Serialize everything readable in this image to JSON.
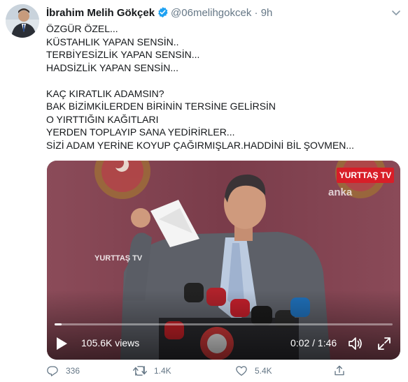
{
  "tweet": {
    "display_name": "İbrahim Melih Gökçek",
    "handle": "@06melihgokcek",
    "separator": "·",
    "time": "9h",
    "text": "ÖZGÜR ÖZEL...\nKÜSTAHLIK YAPAN SENSİN..\nTERBİYESİZLİK YAPAN SENSİN...\nHADSİZLİK YAPAN SENSİN...\n\nKAÇ KIRATLIK ADAMSIN?\nBAK BİZİMKİLERDEN BİRİNİN TERSİNE GELİRSİN\nO YIRTTIĞIN KAĞITLARI\nYERDEN TOPLAYIP SANA YEDİRİRLER...\nSİZİ ADAM YERİNE KOYUP ÇAĞIRMIŞLAR.HADDİNİ BİL ŞOVMEN..."
  },
  "video": {
    "source_logo": "YURTTAŞ TV",
    "watermark_anka": "anka",
    "watermark_yurttas": "YURTTAŞ TV",
    "views": "105.6K views",
    "current_time": "0:02 / 1:46",
    "progress": 0.02
  },
  "actions": {
    "replies": "336",
    "retweets": "1.4K",
    "likes": "5.4K"
  },
  "colors": {
    "brand_red": "#d81e28",
    "verified_blue": "#1da1f2",
    "muted": "#657786"
  }
}
